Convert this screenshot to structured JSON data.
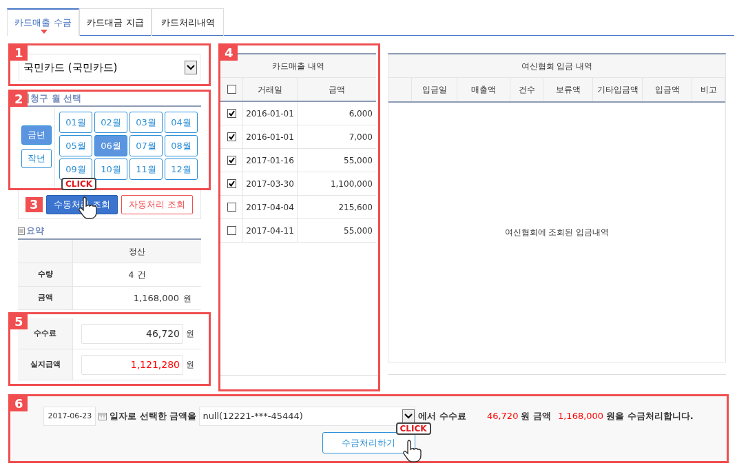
{
  "tabs": [
    {
      "label": "카드매출 수금",
      "selected": true
    },
    {
      "label": "카드대금 지급",
      "selected": false
    },
    {
      "label": "카드처리내역",
      "selected": false
    }
  ],
  "card_select": {
    "badge": "1",
    "value": "국민카드 (국민카드)"
  },
  "month_picker": {
    "badge": "2",
    "title": "청구 월 선택",
    "years": [
      {
        "label": "금년",
        "selected": true
      },
      {
        "label": "작년",
        "selected": false
      }
    ],
    "months": [
      {
        "label": "01월",
        "selected": false
      },
      {
        "label": "02월",
        "selected": false
      },
      {
        "label": "03월",
        "selected": false
      },
      {
        "label": "04월",
        "selected": false
      },
      {
        "label": "05월",
        "selected": false
      },
      {
        "label": "06월",
        "selected": true
      },
      {
        "label": "07월",
        "selected": false
      },
      {
        "label": "08월",
        "selected": false
      },
      {
        "label": "09월",
        "selected": false
      },
      {
        "label": "10월",
        "selected": false
      },
      {
        "label": "11월",
        "selected": false
      },
      {
        "label": "12월",
        "selected": false
      }
    ]
  },
  "query": {
    "badge": "3",
    "callout": "CLICK",
    "buttons": [
      {
        "label": "수동처리 조회",
        "kind": "primary"
      },
      {
        "label": "자동처리 조회",
        "kind": "outline"
      }
    ]
  },
  "summary": {
    "title": "요약",
    "column": "정산",
    "rows": [
      {
        "label": "수량",
        "value": "4 건"
      },
      {
        "label": "금액",
        "value": "1,168,000",
        "unit": "원"
      }
    ],
    "badge": "5",
    "input_rows": [
      {
        "label": "수수료",
        "value": "46,720",
        "unit": "원",
        "emphasis": false
      },
      {
        "label": "실지급액",
        "value": "1,121,280",
        "unit": "원",
        "emphasis": true
      }
    ]
  },
  "sales": {
    "badge": "4",
    "title": "카드매출 내역",
    "select_all": false,
    "columns": [
      "거래일",
      "금액"
    ],
    "rows": [
      {
        "date": "2016-01-01",
        "amount": "6,000",
        "checked": true
      },
      {
        "date": "2016-01-01",
        "amount": "7,000",
        "checked": true
      },
      {
        "date": "2017-01-16",
        "amount": "55,000",
        "checked": true
      },
      {
        "date": "2017-03-30",
        "amount": "1,100,000",
        "checked": true
      },
      {
        "date": "2017-04-04",
        "amount": "215,600",
        "checked": false
      },
      {
        "date": "2017-04-11",
        "amount": "55,000",
        "checked": false
      }
    ]
  },
  "deposits": {
    "title": "여신협회 입금 내역",
    "columns": [
      "입금일",
      "매출액",
      "건수",
      "보류액",
      "기타입금액",
      "입금액",
      "비고"
    ],
    "empty_text": "여신협회에 조회된 입금내역"
  },
  "process": {
    "badge": "6",
    "date": "2017-06-23",
    "text1": "일자로 선택한 금액을",
    "account": "null(12221-***-45444)",
    "text2": "에서 수수료",
    "fee": "46,720",
    "text3": "원 금액",
    "amount": "1,168,000",
    "text4": "원을 수금처리합니다.",
    "button": "수금처리하기",
    "callout": "CLICK"
  }
}
